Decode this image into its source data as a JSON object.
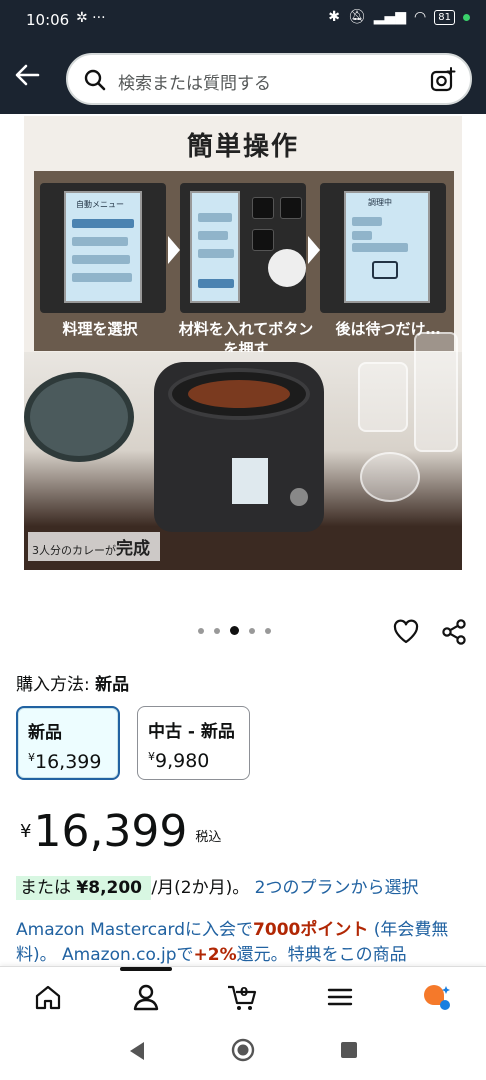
{
  "status": {
    "time": "10:06",
    "battery": "81"
  },
  "search": {
    "placeholder": "検索または質問する"
  },
  "hero": {
    "title": "簡単操作",
    "steps": [
      {
        "caption": "料理を選択"
      },
      {
        "caption": "材料を入れてボタンを押す"
      },
      {
        "caption": "後は待つだけ…"
      }
    ],
    "screen1_label": "自動メニュー",
    "screen3_label": "調理中",
    "completion_small": "3人分のカレーが",
    "completion_big": "完成"
  },
  "carousel": {
    "count": 5,
    "active": 2
  },
  "purchase": {
    "label": "購入方法:",
    "value": "新品"
  },
  "options": [
    {
      "name": "新品",
      "currency": "¥",
      "price": "16,399"
    },
    {
      "name": "中古 - 新品",
      "currency": "¥",
      "price": "9,980"
    }
  ],
  "price": {
    "currency": "¥",
    "value": "16,399",
    "tax": "税込"
  },
  "installment": {
    "prefix": "または",
    "amount": "¥8,200",
    "suffix": "/月(2か月)。",
    "link": "2つのプランから選択"
  },
  "promo": {
    "line1a": "Amazon Mastercardに入会で",
    "points": "7000ポイント",
    "line1b": "(年会費無料)。 Amazon.co.jpで",
    "plus": "+2%",
    "line1c": "還元。特典をこの商品"
  },
  "bottomnav": {
    "cart_count": "0"
  }
}
